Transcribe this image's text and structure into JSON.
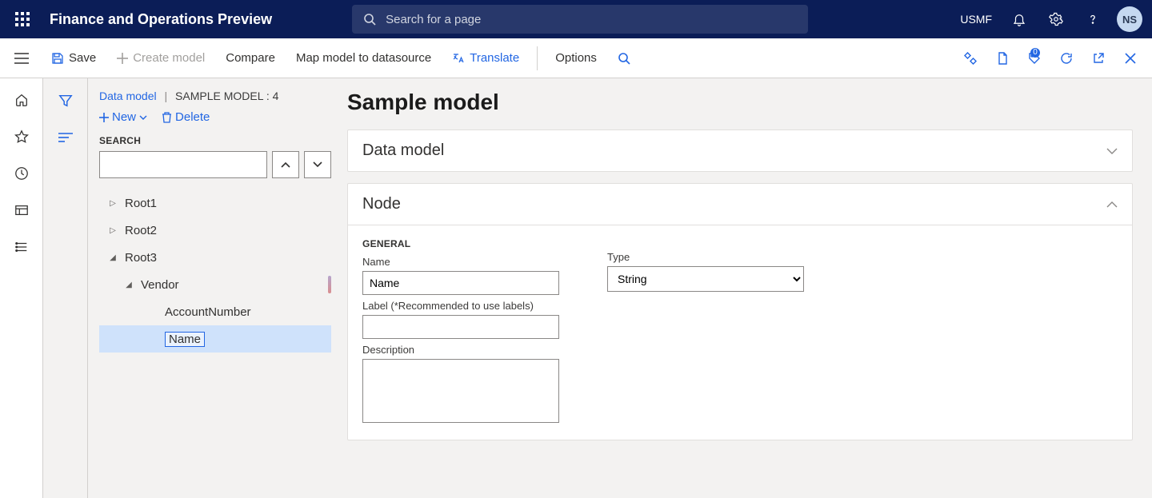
{
  "header": {
    "app_title": "Finance and Operations Preview",
    "search_placeholder": "Search for a page",
    "environment": "USMF",
    "avatar_initials": "NS"
  },
  "cmdbar": {
    "save": "Save",
    "create_model": "Create model",
    "compare": "Compare",
    "map_model": "Map model to datasource",
    "translate": "Translate",
    "options": "Options",
    "badge_count": "0"
  },
  "breadcrumb": {
    "root": "Data model",
    "current": "SAMPLE MODEL : 4"
  },
  "tree_toolbar": {
    "new": "New",
    "delete": "Delete"
  },
  "search_section": {
    "label": "SEARCH"
  },
  "tree": {
    "root1": "Root1",
    "root2": "Root2",
    "root3": "Root3",
    "vendor": "Vendor",
    "account_number": "AccountNumber",
    "name": "Name"
  },
  "page": {
    "title": "Sample model",
    "card_data_model": "Data model",
    "card_node": "Node"
  },
  "node_form": {
    "section": "GENERAL",
    "name_label": "Name",
    "name_value": "Name",
    "label_label": "Label (*Recommended to use labels)",
    "label_value": "",
    "description_label": "Description",
    "description_value": "",
    "type_label": "Type",
    "type_value": "String"
  }
}
